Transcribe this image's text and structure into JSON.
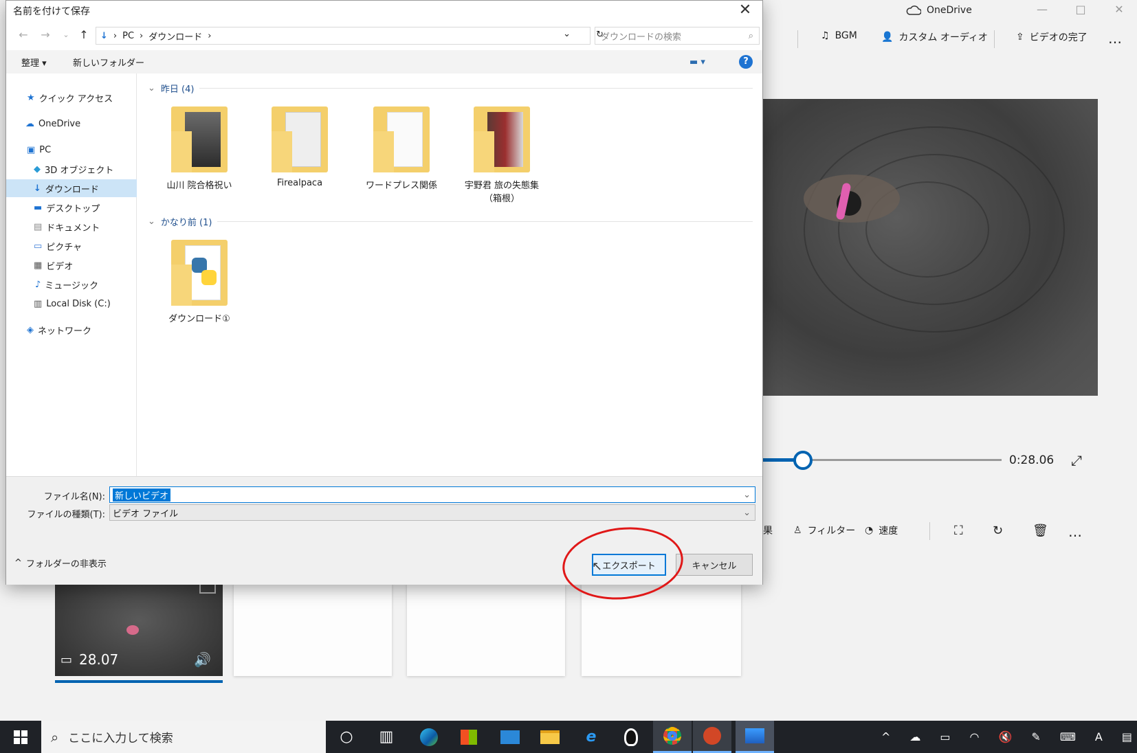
{
  "background_app": {
    "title": "OneDrive",
    "toolbar": {
      "bgm": "BGM",
      "custom_audio": "カスタム オーディオ",
      "finish_video": "ビデオの完了",
      "more": "…"
    },
    "timeline": {
      "time": "0:28.06",
      "progress": 0.17
    },
    "edit_tools": {
      "partial": "果",
      "filter": "フィルター",
      "speed": "速度",
      "more": "…"
    },
    "storyboard": {
      "clip_duration": "28.07"
    }
  },
  "taskbar": {
    "search_placeholder": "ここに入力して検索"
  },
  "dialog": {
    "title": "名前を付けて保存",
    "breadcrumb": [
      "PC",
      "ダウンロード"
    ],
    "search_placeholder": "ダウンロードの検索",
    "commands": {
      "organize": "整理",
      "new_folder": "新しいフォルダー"
    },
    "nav": {
      "quick_access": "クイック アクセス",
      "onedrive": "OneDrive",
      "pc": "PC",
      "objects3d": "3D オブジェクト",
      "downloads": "ダウンロード",
      "desktop": "デスクトップ",
      "documents": "ドキュメント",
      "pictures": "ピクチャ",
      "videos": "ビデオ",
      "music": "ミュージック",
      "local_disk": "Local Disk (C:)",
      "network": "ネットワーク"
    },
    "groups": [
      {
        "header": "昨日 (4)",
        "folders": [
          "山川 院合格祝い",
          "Firealpaca",
          "ワードプレス関係",
          "宇野君 旅の失態集（箱根）"
        ]
      },
      {
        "header": "かなり前 (1)",
        "folders": [
          "ダウンロード①"
        ]
      }
    ],
    "filename_label": "ファイル名(N):",
    "filename_value": "新しいビデオ",
    "filetype_label": "ファイルの種類(T):",
    "filetype_value": "ビデオ ファイル",
    "hide_folders": "フォルダーの非表示",
    "export_button": "エクスポート",
    "cancel_button": "キャンセル"
  },
  "colors": {
    "accent": "#0078d7",
    "annotation": "#e01818"
  }
}
